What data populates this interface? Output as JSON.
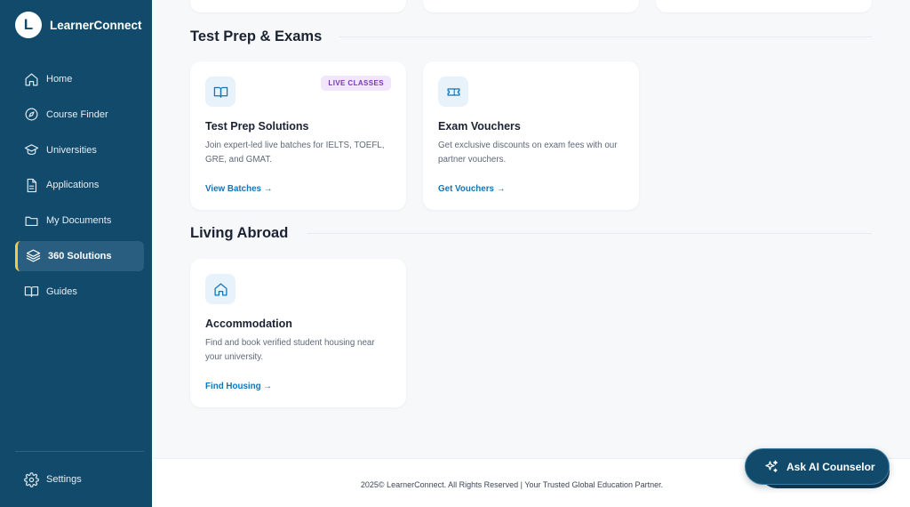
{
  "brand": {
    "logo_letter": "L",
    "name": "LearnerConnect"
  },
  "sidebar": {
    "items": [
      {
        "label": "Home",
        "icon": "home-icon"
      },
      {
        "label": "Course Finder",
        "icon": "compass-icon"
      },
      {
        "label": "Universities",
        "icon": "graduation-cap-icon"
      },
      {
        "label": "Applications",
        "icon": "document-icon"
      },
      {
        "label": "My Documents",
        "icon": "folder-icon"
      },
      {
        "label": "360 Solutions",
        "icon": "layers-icon",
        "active": true
      },
      {
        "label": "Guides",
        "icon": "book-open-icon"
      }
    ],
    "settings_label": "Settings"
  },
  "sections": {
    "test_prep": {
      "title": "Test Prep & Exams",
      "cards": [
        {
          "title": "Test Prep Solutions",
          "badge": "LIVE CLASSES",
          "description": "Join expert-led live batches for IELTS, TOEFL, GRE, and GMAT.",
          "link": "View Batches →",
          "icon": "book-icon"
        },
        {
          "title": "Exam Vouchers",
          "description": "Get exclusive discounts on exam fees with our partner vouchers.",
          "link": "Get Vouchers →",
          "icon": "ticket-icon"
        }
      ]
    },
    "living_abroad": {
      "title": "Living Abroad",
      "cards": [
        {
          "title": "Accommodation",
          "description": "Find and book verified student housing near your university.",
          "link": "Find Housing →",
          "icon": "house-icon"
        }
      ]
    }
  },
  "footer": {
    "text": "2025© LearnerConnect. All Rights Reserved | Your Trusted Global Education Partner."
  },
  "fab": {
    "label": "Ask AI Counselor",
    "icon": "sparkles-icon"
  },
  "colors": {
    "sidebar_bg": "#114a6b",
    "accent_link": "#1674b5",
    "active_marker": "#f2c94c",
    "badge_text": "#7b35b8"
  }
}
